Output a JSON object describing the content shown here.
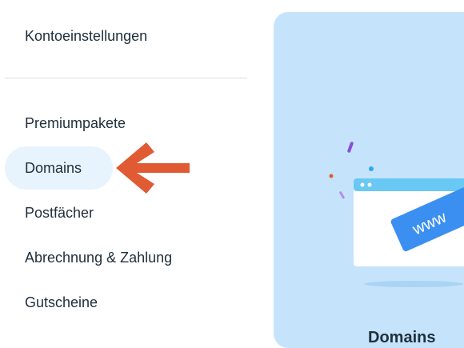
{
  "sidebar": {
    "items": [
      {
        "label": "Kontoeinstellungen"
      },
      {
        "label": "Premiumpakete"
      },
      {
        "label": "Domains",
        "active": true
      },
      {
        "label": "Postfächer"
      },
      {
        "label": "Abrechnung & Zahlung"
      },
      {
        "label": "Gutscheine"
      }
    ]
  },
  "annotation": {
    "icon": "arrow-left-icon",
    "color": "#e05a33"
  },
  "card": {
    "background": "#c5e4fb",
    "tag_text": "www",
    "title_partial": "Domains"
  }
}
